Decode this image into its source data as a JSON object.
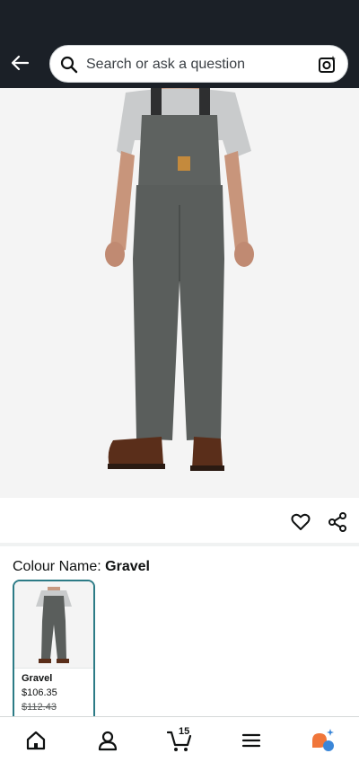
{
  "search": {
    "placeholder": "Search or ask a question"
  },
  "product": {
    "colour_label": "Colour Name:",
    "colour_value": "Gravel"
  },
  "swatches": [
    {
      "name": "Gravel",
      "price": "$106.35",
      "old_price": "$112.43",
      "selected": true
    }
  ],
  "bottom_nav": {
    "cart_count": "15",
    "items": [
      "home-icon",
      "account-icon",
      "cart-icon",
      "menu-icon",
      "rufus-icon"
    ]
  },
  "colors": {
    "header_bg": "#1b2027",
    "accent": "#2c7b86",
    "garment": "#5e6260",
    "boots": "#5a2e1a"
  }
}
